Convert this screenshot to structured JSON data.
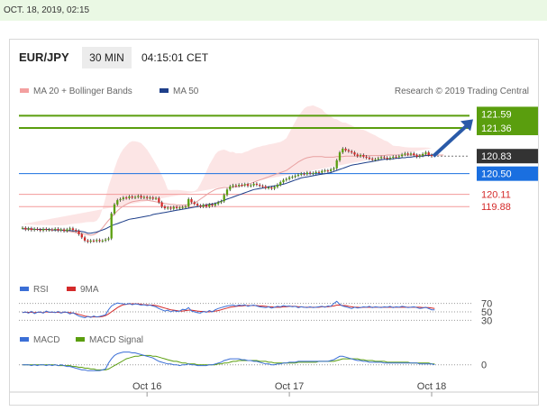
{
  "timestamp": "OCT. 18, 2019, 02:15",
  "header": {
    "pair": "EUR/JPY",
    "timeframe": "30 MIN",
    "clock": "04:15:01 CET"
  },
  "credit": "Research © 2019 Trading Central",
  "colors": {
    "up": "#5a9e0e",
    "down": "#d42a2a",
    "ma50": "#1e3f8a",
    "bollinger": "#f3a0a0",
    "current_bg": "#333333",
    "pivot_bg": "#1a6fe0",
    "arrow": "#2a5aa8",
    "rsi": "#3b6fd6",
    "rsi_ma": "#d42a2a",
    "macd": "#3b6fd6",
    "macd_signal": "#5a9e0e"
  },
  "chart_data": [
    {
      "type": "candlestick",
      "legend": [
        "MA 20 + Bollinger Bands",
        "MA 50"
      ],
      "x_ticks": [
        {
          "label": "Oct 16",
          "index": 42
        },
        {
          "label": "Oct 17",
          "index": 90
        },
        {
          "label": "Oct 18",
          "index": 138
        }
      ],
      "ylim": [
        118.95,
        121.75
      ],
      "close": [
        119.48,
        119.45,
        119.47,
        119.44,
        119.46,
        119.45,
        119.43,
        119.46,
        119.44,
        119.45,
        119.44,
        119.46,
        119.43,
        119.45,
        119.42,
        119.45,
        119.47,
        119.44,
        119.42,
        119.36,
        119.3,
        119.24,
        119.22,
        119.24,
        119.23,
        119.25,
        119.23,
        119.24,
        119.26,
        119.28,
        119.75,
        119.92,
        120.0,
        120.02,
        120.05,
        120.04,
        120.07,
        120.05,
        120.06,
        120.08,
        120.05,
        120.06,
        120.04,
        120.05,
        120.03,
        120.04,
        119.96,
        119.88,
        119.85,
        119.86,
        119.84,
        119.87,
        119.85,
        119.86,
        119.87,
        119.88,
        120.02,
        119.96,
        119.93,
        119.9,
        119.88,
        119.91,
        119.88,
        119.92,
        119.9,
        119.93,
        119.96,
        119.98,
        120.1,
        120.2,
        120.26,
        120.28,
        120.27,
        120.29,
        120.28,
        120.3,
        120.27,
        120.28,
        120.31,
        120.29,
        120.27,
        120.26,
        120.23,
        120.24,
        120.22,
        120.25,
        120.29,
        120.34,
        120.38,
        120.4,
        120.43,
        120.44,
        120.46,
        120.48,
        120.5,
        120.49,
        120.52,
        120.5,
        120.51,
        120.53,
        120.52,
        120.55,
        120.56,
        120.55,
        120.58,
        120.6,
        120.75,
        120.9,
        120.97,
        120.94,
        120.92,
        120.9,
        120.86,
        120.83,
        120.85,
        120.82,
        120.8,
        120.78,
        120.76,
        120.77,
        120.79,
        120.81,
        120.8,
        120.78,
        120.8,
        120.82,
        120.81,
        120.83,
        120.86,
        120.88,
        120.86,
        120.88,
        120.85,
        120.82,
        120.84,
        120.87,
        120.9,
        120.85,
        120.83
      ],
      "ma50": [
        119.46,
        119.46,
        119.46,
        119.46,
        119.45,
        119.45,
        119.45,
        119.45,
        119.45,
        119.45,
        119.44,
        119.44,
        119.44,
        119.44,
        119.43,
        119.43,
        119.43,
        119.42,
        119.42,
        119.42,
        119.41,
        119.4,
        119.38,
        119.38,
        119.39,
        119.4,
        119.42,
        119.44,
        119.46,
        119.49,
        119.52,
        119.54,
        119.56,
        119.58,
        119.6,
        119.62,
        119.64,
        119.65,
        119.66,
        119.67,
        119.68,
        119.69,
        119.7,
        119.71,
        119.73,
        119.74,
        119.75,
        119.76,
        119.77,
        119.78,
        119.79,
        119.8,
        119.81,
        119.82,
        119.83,
        119.84,
        119.85,
        119.86,
        119.87,
        119.88,
        119.89,
        119.9,
        119.91,
        119.92,
        119.93,
        119.94,
        119.96,
        119.98,
        120.0,
        120.02,
        120.04,
        120.06,
        120.08,
        120.1,
        120.12,
        120.14,
        120.16,
        120.18,
        120.2,
        120.21,
        120.22,
        120.23,
        120.24,
        120.25,
        120.26,
        120.27,
        120.28,
        120.29,
        120.3,
        120.32,
        120.34,
        120.36,
        120.38,
        120.4,
        120.42,
        120.43,
        120.44,
        120.45,
        120.46,
        120.47,
        120.48,
        120.49,
        120.5,
        120.51,
        120.52,
        120.54,
        120.56,
        120.58,
        120.6,
        120.62,
        120.64,
        120.66,
        120.67,
        120.68,
        120.69,
        120.7,
        120.71,
        120.72,
        120.73,
        120.74,
        120.75,
        120.76,
        120.77,
        120.77,
        120.78,
        120.78,
        120.79,
        120.79,
        120.8,
        120.8,
        120.81,
        120.81,
        120.82,
        120.82,
        120.83,
        120.83,
        120.84,
        120.84,
        120.85,
        120.86,
        120.87
      ],
      "ma20": [
        119.46,
        119.46,
        119.45,
        119.45,
        119.45,
        119.45,
        119.45,
        119.45,
        119.45,
        119.44,
        119.44,
        119.44,
        119.44,
        119.44,
        119.43,
        119.42,
        119.41,
        119.4,
        119.39,
        119.38,
        119.37,
        119.36,
        119.35,
        119.34,
        119.35,
        119.38,
        119.42,
        119.48,
        119.55,
        119.62,
        119.68,
        119.74,
        119.8,
        119.85,
        119.89,
        119.92,
        119.95,
        119.97,
        119.98,
        119.99,
        120.0,
        120.0,
        120.0,
        119.99,
        119.98,
        119.97,
        119.96,
        119.95,
        119.94,
        119.93,
        119.92,
        119.92,
        119.91,
        119.91,
        119.91,
        119.91,
        119.92,
        119.93,
        119.95,
        119.98,
        120.02,
        120.06,
        120.1,
        120.14,
        120.17,
        120.2,
        120.22,
        120.23,
        120.24,
        120.24,
        120.24,
        120.25,
        120.25,
        120.26,
        120.27,
        120.29,
        120.3,
        120.32,
        120.34,
        120.36,
        120.38,
        120.4,
        120.42,
        120.44,
        120.46,
        120.48,
        120.5,
        120.52,
        120.54,
        120.56,
        120.6,
        120.64,
        120.68,
        120.72,
        120.75,
        120.78,
        120.8,
        120.81,
        120.82,
        120.82,
        120.82,
        120.82,
        120.81,
        120.81,
        120.81,
        120.81,
        120.82,
        120.82,
        120.82,
        120.83,
        120.83,
        120.83,
        120.83,
        120.83,
        120.83,
        120.84,
        120.84,
        120.84,
        120.84,
        120.84,
        120.84,
        120.84,
        120.84,
        120.85,
        120.85,
        120.85,
        120.85,
        120.85,
        120.85,
        120.85,
        120.85,
        120.85,
        120.85,
        120.85,
        120.85,
        120.85,
        120.85,
        120.85,
        120.85,
        120.85,
        120.85,
        120.85,
        120.85
      ],
      "levels": [
        {
          "label": "121.59",
          "value": 121.59,
          "style": "resistance"
        },
        {
          "label": "121.36",
          "value": 121.36,
          "style": "resistance"
        },
        {
          "label": "120.83",
          "value": 120.83,
          "style": "current"
        },
        {
          "label": "120.50",
          "value": 120.5,
          "style": "pivot"
        },
        {
          "label": "120.11",
          "value": 120.11,
          "style": "support"
        },
        {
          "label": "119.88",
          "value": 119.88,
          "style": "support"
        }
      ]
    },
    {
      "type": "line",
      "legend": [
        "RSI",
        "9MA"
      ],
      "y_ticks": [
        "70",
        "50",
        "30"
      ],
      "ylim": [
        20,
        80
      ],
      "rsi": [
        48,
        50,
        47,
        51,
        46,
        49,
        50,
        47,
        52,
        49,
        50,
        48,
        51,
        47,
        50,
        49,
        45,
        48,
        44,
        40,
        38,
        36,
        39,
        37,
        40,
        38,
        39,
        41,
        43,
        55,
        64,
        68,
        71,
        70,
        69,
        68,
        70,
        67,
        69,
        68,
        66,
        67,
        65,
        66,
        64,
        62,
        58,
        55,
        52,
        54,
        50,
        53,
        51,
        52,
        56,
        55,
        60,
        52,
        50,
        48,
        47,
        51,
        49,
        53,
        50,
        55,
        58,
        60,
        62,
        64,
        65,
        66,
        64,
        66,
        65,
        67,
        63,
        65,
        66,
        64,
        62,
        61,
        60,
        62,
        59,
        61,
        63,
        62,
        65,
        63,
        64,
        62,
        63,
        60,
        62,
        61,
        60,
        62,
        60,
        61,
        62,
        63,
        61,
        64,
        63,
        70,
        75,
        68,
        64,
        62,
        60,
        58,
        61,
        59,
        60,
        62,
        61,
        63,
        60,
        62,
        61,
        60,
        62,
        61,
        63,
        60,
        62,
        61,
        63,
        62,
        60,
        61,
        62,
        60,
        58,
        59,
        61,
        58,
        55,
        55
      ],
      "rsi_ma": [
        49,
        49,
        49,
        49,
        48,
        49,
        49,
        48,
        50,
        49,
        49,
        49,
        49,
        48,
        49,
        49,
        48,
        47,
        46,
        44,
        42,
        40,
        39,
        38,
        38,
        38,
        38,
        39,
        41,
        45,
        50,
        55,
        60,
        64,
        67,
        68,
        69,
        69,
        69,
        69,
        68,
        67,
        67,
        66,
        66,
        65,
        63,
        61,
        59,
        57,
        55,
        54,
        53,
        52,
        52,
        53,
        54,
        54,
        53,
        52,
        51,
        51,
        50,
        50,
        51,
        52,
        53,
        55,
        57,
        59,
        61,
        62,
        63,
        64,
        64,
        65,
        65,
        65,
        65,
        65,
        64,
        64,
        63,
        62,
        62,
        61,
        61,
        61,
        62,
        62,
        63,
        63,
        63,
        62,
        62,
        61,
        61,
        61,
        61,
        61,
        61,
        62,
        62,
        62,
        63,
        64,
        66,
        66,
        65,
        65,
        63,
        62,
        61,
        61,
        60,
        61,
        61,
        61,
        61,
        61,
        61,
        61,
        61,
        61,
        61,
        61,
        61,
        61,
        61,
        61,
        61,
        61,
        61,
        61,
        61,
        60,
        60,
        60,
        59,
        58
      ]
    },
    {
      "type": "line",
      "legend": [
        "MACD",
        "MACD Signal"
      ],
      "y_ticks": [
        "0"
      ],
      "ylim": [
        -0.12,
        0.22
      ],
      "macd": [
        0.0,
        0.0,
        0.0,
        -0.01,
        0.0,
        -0.01,
        0.0,
        0.0,
        -0.01,
        0.0,
        -0.01,
        0.0,
        -0.01,
        0.0,
        -0.01,
        -0.02,
        -0.02,
        -0.03,
        -0.04,
        -0.05,
        -0.06,
        -0.06,
        -0.07,
        -0.07,
        -0.07,
        -0.07,
        -0.07,
        -0.06,
        -0.05,
        0.02,
        0.07,
        0.11,
        0.13,
        0.14,
        0.15,
        0.15,
        0.15,
        0.14,
        0.14,
        0.13,
        0.12,
        0.11,
        0.1,
        0.09,
        0.08,
        0.06,
        0.04,
        0.03,
        0.02,
        0.01,
        0.01,
        0.0,
        0.0,
        -0.01,
        0.0,
        0.0,
        0.01,
        0.0,
        0.0,
        -0.01,
        -0.01,
        -0.01,
        -0.01,
        0.0,
        0.0,
        0.01,
        0.02,
        0.03,
        0.05,
        0.06,
        0.07,
        0.07,
        0.07,
        0.07,
        0.06,
        0.06,
        0.05,
        0.05,
        0.04,
        0.04,
        0.03,
        0.02,
        0.01,
        0.01,
        0.0,
        0.0,
        0.01,
        0.01,
        0.02,
        0.02,
        0.03,
        0.03,
        0.03,
        0.04,
        0.04,
        0.04,
        0.04,
        0.04,
        0.04,
        0.04,
        0.04,
        0.04,
        0.04,
        0.04,
        0.05,
        0.06,
        0.08,
        0.1,
        0.1,
        0.09,
        0.08,
        0.07,
        0.06,
        0.05,
        0.05,
        0.04,
        0.04,
        0.03,
        0.03,
        0.03,
        0.03,
        0.03,
        0.02,
        0.02,
        0.02,
        0.02,
        0.02,
        0.02,
        0.02,
        0.02,
        0.02,
        0.02,
        0.02,
        0.02,
        0.01,
        0.01,
        0.01,
        0.01,
        0.01,
        0.0
      ],
      "signal": [
        0.0,
        0.0,
        0.0,
        0.0,
        0.0,
        0.0,
        0.0,
        0.0,
        0.0,
        0.0,
        0.0,
        0.0,
        -0.01,
        -0.01,
        -0.01,
        -0.01,
        -0.01,
        -0.02,
        -0.02,
        -0.03,
        -0.03,
        -0.04,
        -0.04,
        -0.05,
        -0.05,
        -0.06,
        -0.06,
        -0.06,
        -0.06,
        -0.05,
        -0.03,
        -0.01,
        0.01,
        0.03,
        0.05,
        0.07,
        0.08,
        0.09,
        0.1,
        0.1,
        0.11,
        0.11,
        0.11,
        0.11,
        0.1,
        0.1,
        0.09,
        0.08,
        0.07,
        0.06,
        0.05,
        0.04,
        0.04,
        0.03,
        0.02,
        0.02,
        0.01,
        0.01,
        0.01,
        0.0,
        0.0,
        0.0,
        0.0,
        0.0,
        0.0,
        0.0,
        0.01,
        0.01,
        0.02,
        0.02,
        0.03,
        0.04,
        0.04,
        0.05,
        0.05,
        0.05,
        0.05,
        0.05,
        0.05,
        0.05,
        0.04,
        0.04,
        0.04,
        0.03,
        0.03,
        0.02,
        0.02,
        0.02,
        0.02,
        0.02,
        0.02,
        0.02,
        0.02,
        0.03,
        0.03,
        0.03,
        0.03,
        0.03,
        0.03,
        0.03,
        0.04,
        0.04,
        0.04,
        0.04,
        0.04,
        0.04,
        0.05,
        0.06,
        0.07,
        0.07,
        0.07,
        0.07,
        0.07,
        0.07,
        0.06,
        0.06,
        0.05,
        0.05,
        0.05,
        0.04,
        0.04,
        0.04,
        0.04,
        0.03,
        0.03,
        0.03,
        0.03,
        0.03,
        0.03,
        0.03,
        0.03,
        0.02,
        0.02,
        0.02,
        0.02,
        0.02,
        0.02,
        0.02,
        0.01,
        0.01
      ]
    }
  ]
}
